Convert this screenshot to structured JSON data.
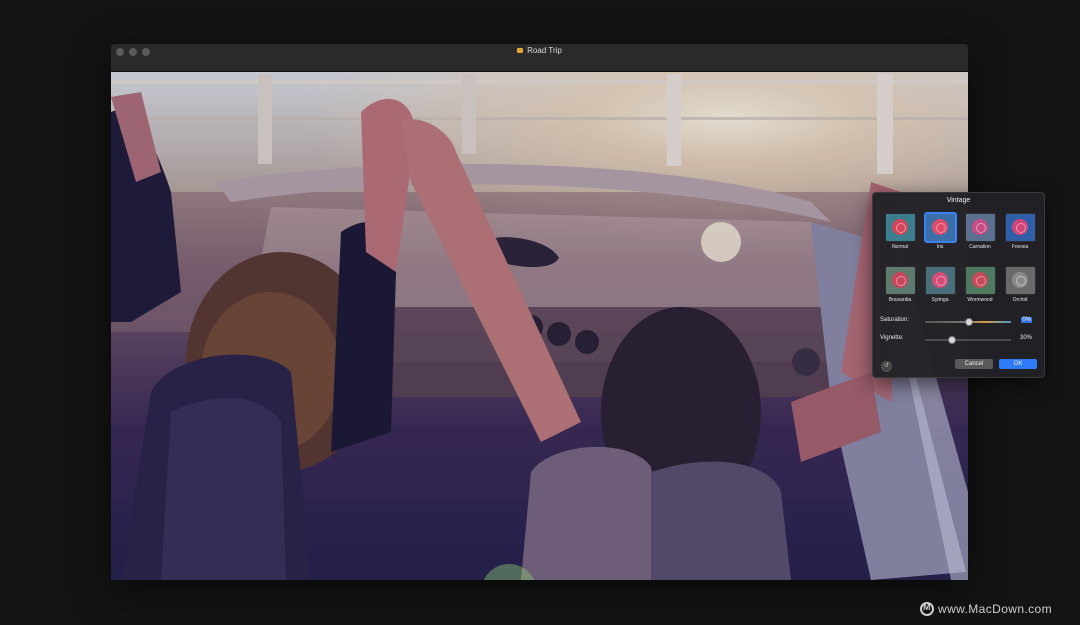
{
  "window": {
    "title": "Road Trip"
  },
  "vintage_panel": {
    "title": "Vintage",
    "presets": [
      {
        "label": "Normal",
        "selected": false,
        "color": "#d2455a"
      },
      {
        "label": "Iris",
        "selected": true,
        "color": "#e04a6a"
      },
      {
        "label": "Carnation",
        "selected": false,
        "color": "#c64d86"
      },
      {
        "label": "Freesia",
        "selected": false,
        "color": "#d24576"
      },
      {
        "label": "Bouvardia",
        "selected": false,
        "color": "#c8465a"
      },
      {
        "label": "Syringa",
        "selected": false,
        "color": "#d44c78"
      },
      {
        "label": "Wormwood",
        "selected": false,
        "color": "#c8495a"
      },
      {
        "label": "Orchid",
        "selected": false,
        "color": "#8a8a8a"
      }
    ],
    "saturation": {
      "label": "Saturation:",
      "value": "0%",
      "level": 0.5
    },
    "vignette": {
      "label": "Vignette:",
      "value": "30%",
      "level": 0.3
    },
    "cancel_label": "Cancel",
    "ok_label": "OK",
    "revert_icon": "revert-icon",
    "accent": "#2d7cf6"
  },
  "watermark": {
    "text": "www.MacDown.com"
  }
}
